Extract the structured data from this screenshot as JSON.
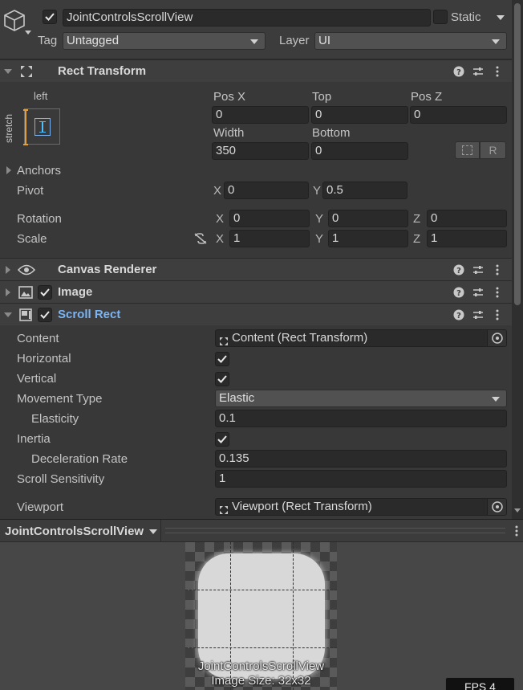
{
  "header": {
    "object_name": "JointControlsScrollView",
    "static_label": "Static",
    "tag_label": "Tag",
    "tag_value": "Untagged",
    "layer_label": "Layer",
    "layer_value": "UI"
  },
  "rect_transform": {
    "title": "Rect Transform",
    "anchor_h": "left",
    "anchor_v": "stretch",
    "pos_x_label": "Pos X",
    "top_label": "Top",
    "pos_z_label": "Pos Z",
    "pos_x": "0",
    "top": "0",
    "pos_z": "0",
    "width_label": "Width",
    "bottom_label": "Bottom",
    "width": "350",
    "bottom": "0",
    "r_button": "R",
    "anchors_label": "Anchors",
    "pivot_label": "Pivot",
    "pivot_x": "0",
    "pivot_y": "0.5",
    "rotation_label": "Rotation",
    "rot_x": "0",
    "rot_y": "0",
    "rot_z": "0",
    "scale_label": "Scale",
    "scale_x": "1",
    "scale_y": "1",
    "scale_z": "1",
    "x": "X",
    "y": "Y",
    "z": "Z"
  },
  "components": {
    "canvas_renderer": "Canvas Renderer",
    "image": "Image",
    "scroll_rect": "Scroll Rect"
  },
  "scroll_rect": {
    "content_label": "Content",
    "content_value": "Content (Rect Transform)",
    "horizontal_label": "Horizontal",
    "vertical_label": "Vertical",
    "movement_type_label": "Movement Type",
    "movement_type_value": "Elastic",
    "elasticity_label": "Elasticity",
    "elasticity_value": "0.1",
    "inertia_label": "Inertia",
    "deceleration_label": "Deceleration Rate",
    "deceleration_value": "0.135",
    "scroll_sensitivity_label": "Scroll Sensitivity",
    "scroll_sensitivity_value": "1",
    "viewport_label": "Viewport",
    "viewport_value": "Viewport (Rect Transform)"
  },
  "preview": {
    "title": "JointControlsScrollView",
    "caption_name": "JointControlsScrollView",
    "caption_size": "Image Size: 32x32",
    "fps": "FPS 4"
  },
  "colors": {
    "accent_blue": "#7ab4f5",
    "background": "#383838",
    "field_bg": "#2a2a2a"
  }
}
